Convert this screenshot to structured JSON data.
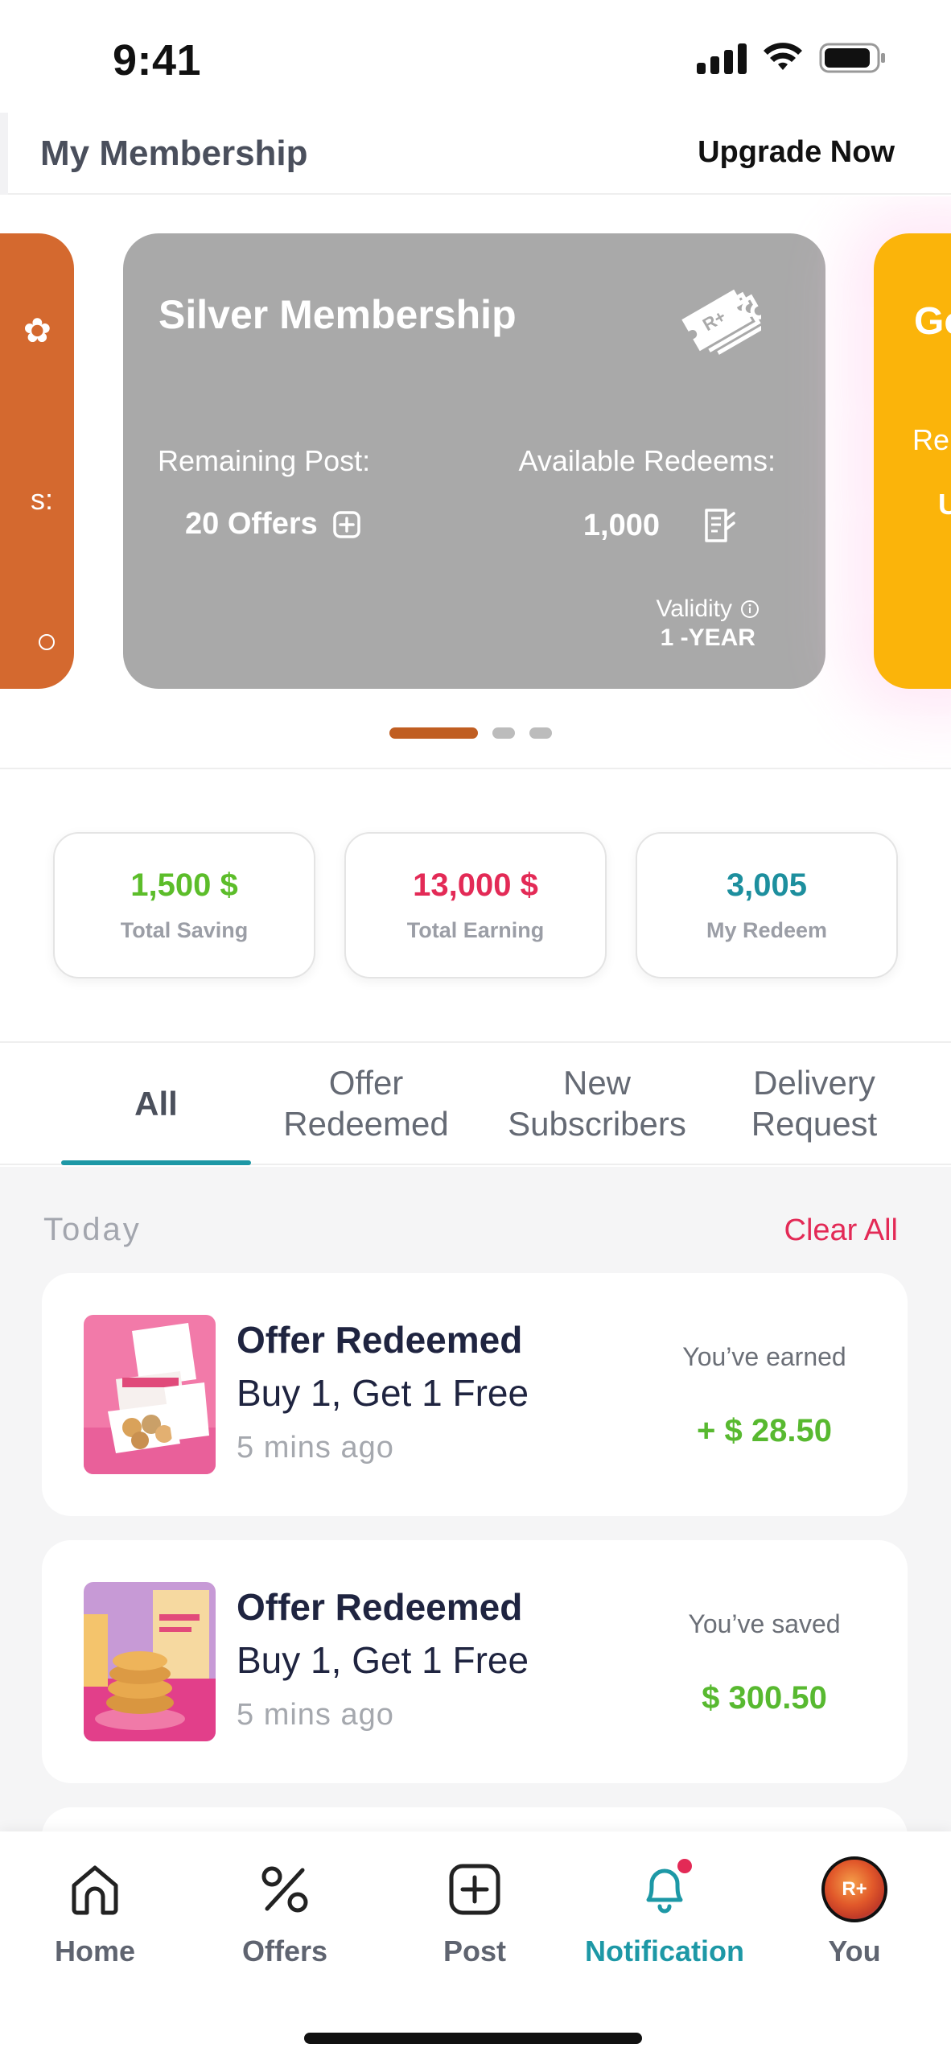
{
  "status_bar": {
    "time": "9:41"
  },
  "header": {
    "title": "My Membership",
    "upgrade_label": "Upgrade Now"
  },
  "carousel": {
    "prev_card": {
      "color": "#d4692f"
    },
    "current_card": {
      "title": "Silver Membership",
      "remaining_post_label": "Remaining Post:",
      "remaining_post_value": "20 Offers",
      "available_redeems_label": "Available Redeems:",
      "available_redeems_value": "1,000",
      "validity_label": "Validity",
      "validity_value": "1 -YEAR",
      "color": "#a9a9a9"
    },
    "next_card": {
      "color": "#fbb40a"
    },
    "page_count": 3,
    "active_page": 1
  },
  "stats": [
    {
      "value": "1,500  $",
      "label": "Total Saving",
      "color": "#5cbd2a"
    },
    {
      "value": "13,000 $",
      "label": "Total Earning",
      "color": "#e32a56"
    },
    {
      "value": "3,005",
      "label": "My Redeem",
      "color": "#1d8f9e"
    }
  ],
  "tabs": {
    "all": "All",
    "offer_redeemed": [
      "Offer",
      "Redeemed"
    ],
    "new_subscribers": [
      "New",
      "Subscribers"
    ],
    "delivery_request": [
      "Delivery",
      "Request"
    ],
    "active": "All"
  },
  "notifications": {
    "section_label": "Today",
    "clear_all_label": "Clear All",
    "items": [
      {
        "title": "Offer Redeemed",
        "description": "Buy 1, Get 1 Free",
        "time": "5 mins ago",
        "amount_label": "You’ve earned",
        "amount": "+ $ 28.50"
      },
      {
        "title": "Offer Redeemed",
        "description": "Buy 1, Get 1 Free",
        "time": "5 mins ago",
        "amount_label": "You’ve saved",
        "amount": "$ 300.50"
      }
    ]
  },
  "bottom_nav": {
    "home": "Home",
    "offers": "Offers",
    "post": "Post",
    "notification": "Notification",
    "you": "You",
    "active": "Notification",
    "accent_color": "#1d98a6"
  }
}
